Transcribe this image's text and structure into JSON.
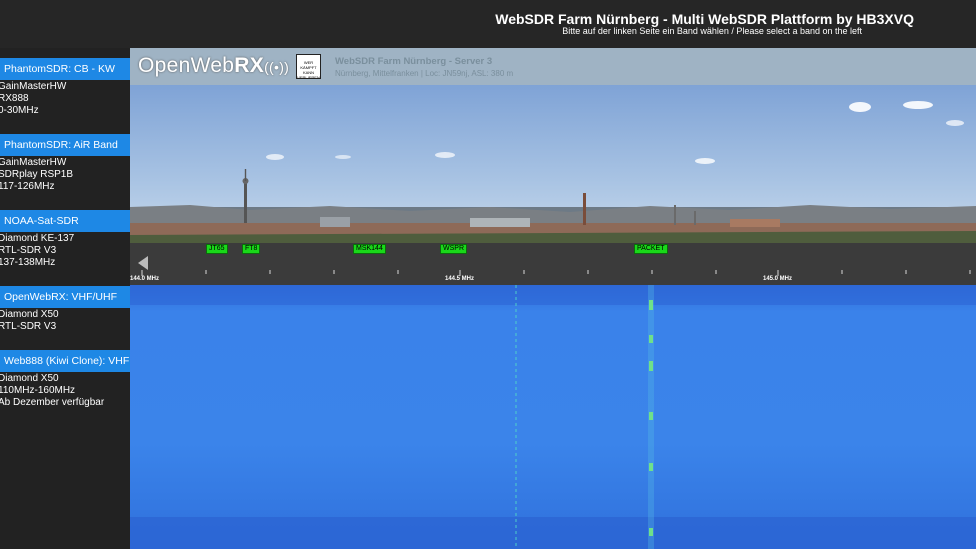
{
  "header": {
    "title": "WebSDR Farm Nürnberg - Multi WebSDR Plattform by HB3XVQ",
    "subtitle": "Bitte auf der linken Seite ein Band wählen / Please select a band on the left"
  },
  "sidebar": {
    "bands": [
      {
        "label": "PhantomSDR: CB - KW",
        "info": [
          "GainMasterHW",
          "RX888",
          "0-30MHz"
        ]
      },
      {
        "label": "PhantomSDR: AiR Band",
        "info": [
          "GainMasterHW",
          "SDRplay RSP1B",
          "117-126MHz"
        ]
      },
      {
        "label": "NOAA-Sat-SDR",
        "info": [
          "Diamond KE-137",
          "RTL-SDR V3",
          "137-138MHz"
        ]
      },
      {
        "label": "OpenWebRX: VHF/UHF",
        "info": [
          "Diamond X50",
          "RTL-SDR V3"
        ]
      },
      {
        "label": "Web888 (Kiwi Clone): VHF",
        "info": [
          "Diamond X50",
          "110MHz-160MHz",
          "Ab Dezember verfügbar"
        ]
      }
    ]
  },
  "receiver": {
    "logo_open": "Open",
    "logo_web": "Web",
    "logo_rx": "RX",
    "avatar_text": "WER KÄMPFT KANN VERLIEREN · STEREN",
    "server_title": "WebSDR Farm Nürnberg - Server 3",
    "location": "Nürnberg, Mittelfranken | Loc: JN59nj, ASL: 380 m"
  },
  "scale": {
    "bookmarks": [
      "JT65",
      "FT8",
      "MSK144",
      "WSPR",
      "PACKET"
    ],
    "ticks": [
      "144.0 MHz",
      "144.5 MHz",
      "145.0 MHz"
    ]
  }
}
